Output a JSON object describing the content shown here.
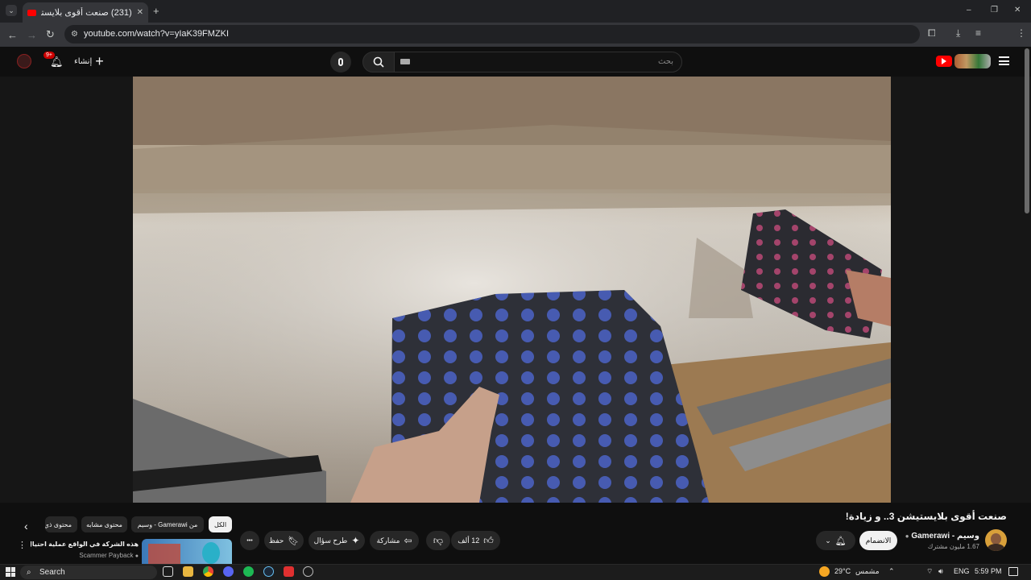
{
  "browser": {
    "tab_title": "(231) صنعت أقوى بلايستيشن",
    "new_tab_symbol": "+",
    "url": "youtube.com/watch?v=yIaK39FMZKI",
    "window_controls": [
      "–",
      "❐",
      "✕"
    ]
  },
  "youtube": {
    "header": {
      "search_placeholder": "بحث",
      "create_label": "إنشاء",
      "notification_count": "9+"
    },
    "video": {
      "title": "صنعت أقوى بلايستيشن 3.. و زيادة!",
      "channel_name": "وسيم - Gamerawi",
      "subscribers": "1.67 مليون مشترك",
      "subscribe_label": "الانضمام",
      "like_count": "12 ألف",
      "share_label": "مشاركة",
      "ask_label": "طرح سؤال",
      "save_label": "حفظ",
      "more_label": "•••"
    },
    "chips": [
      "الكل",
      "من Gamerawi - وسيم",
      "محتوى مشابه",
      "محتوى ذي صلة"
    ],
    "recommendation": {
      "title": "هذه الشركة في الواقع عملية احتيال سرية",
      "channel": "Scammer Payback"
    }
  },
  "taskbar": {
    "search_label": "Search",
    "weather": "29°C",
    "weather_desc": "مشمس",
    "language": "ENG",
    "time": "5:59 PM"
  },
  "colors": {
    "youtube_red": "#ff0000",
    "background": "#0f0f0f",
    "chip_bg": "#272727"
  }
}
